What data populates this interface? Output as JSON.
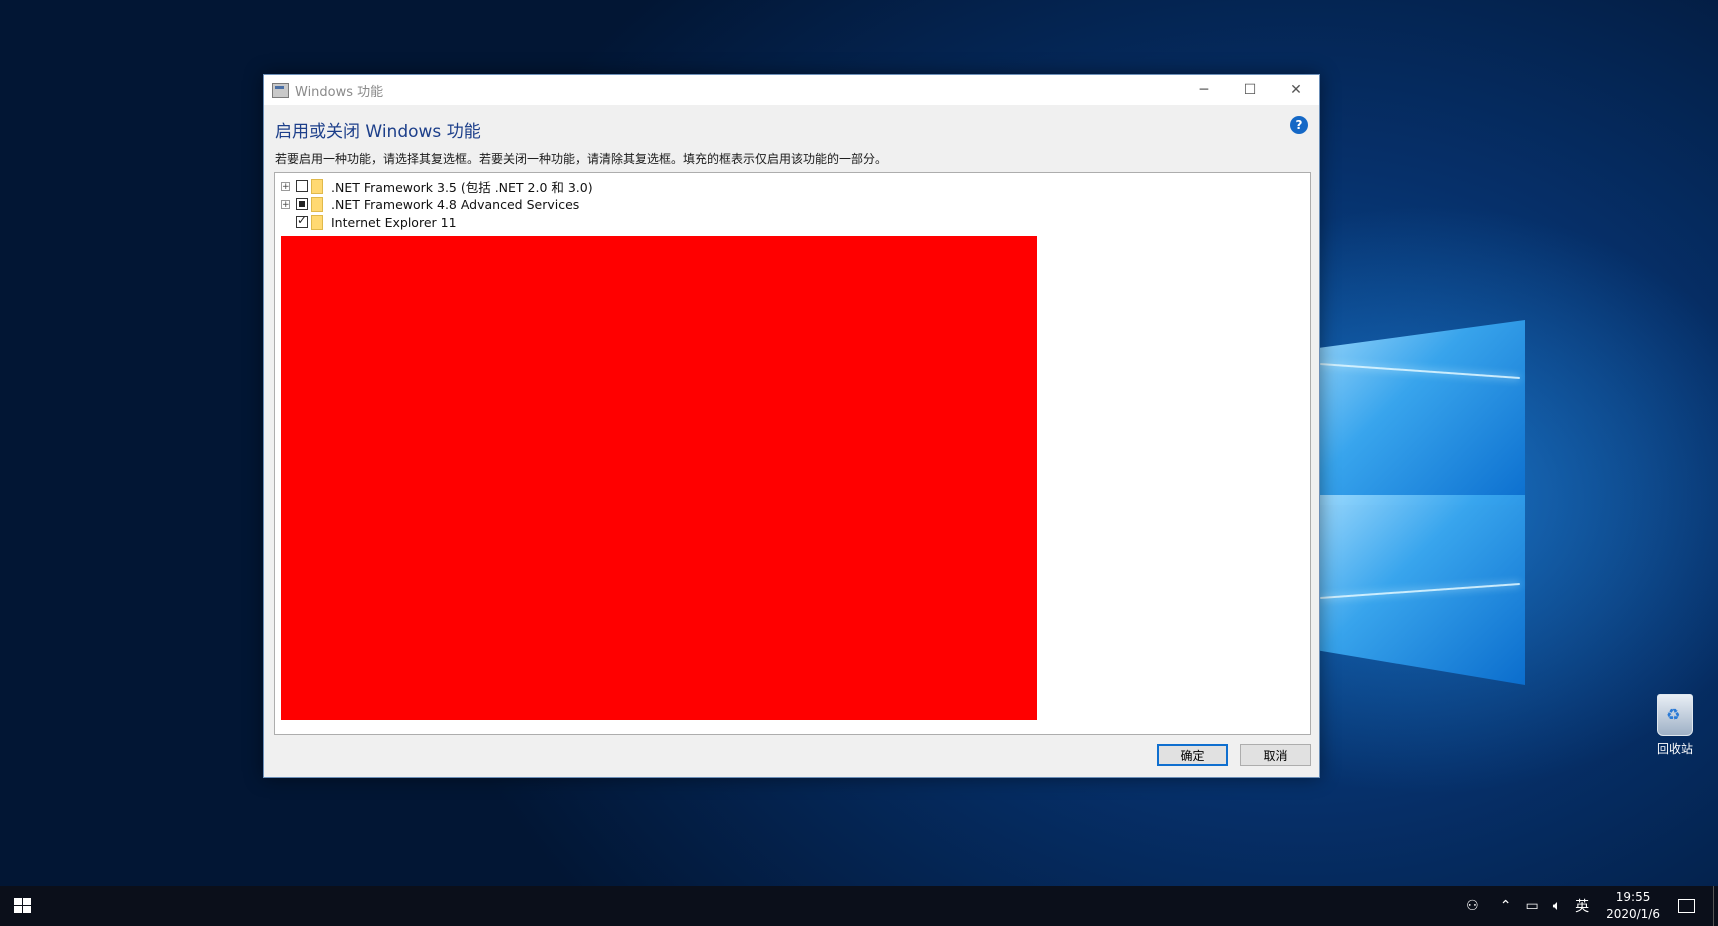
{
  "window": {
    "title": "Windows 功能",
    "minimize_icon": "─",
    "maximize_icon": "☐",
    "close_icon": "✕"
  },
  "dialog": {
    "heading": "启用或关闭 Windows 功能",
    "help_icon": "?",
    "description": "若要启用一种功能，请选择其复选框。若要关闭一种功能，请清除其复选框。填充的框表示仅启用该功能的一部分。"
  },
  "features": [
    {
      "label": ".NET Framework 3.5 (包括 .NET 2.0 和 3.0)",
      "expandable": true,
      "state": "unchecked"
    },
    {
      "label": ".NET Framework 4.8 Advanced Services",
      "expandable": true,
      "state": "partial"
    },
    {
      "label": "Internet Explorer 11",
      "expandable": false,
      "state": "checked"
    }
  ],
  "buttons": {
    "ok": "确定",
    "cancel": "取消"
  },
  "desktop": {
    "recycle_bin": "回收站"
  },
  "taskbar": {
    "ime": "英",
    "time": "19:55",
    "date": "2020/1/6"
  },
  "colors": {
    "redacted": "#ff0000",
    "heading": "#1d3f8a",
    "accent": "#0f6fcf"
  }
}
